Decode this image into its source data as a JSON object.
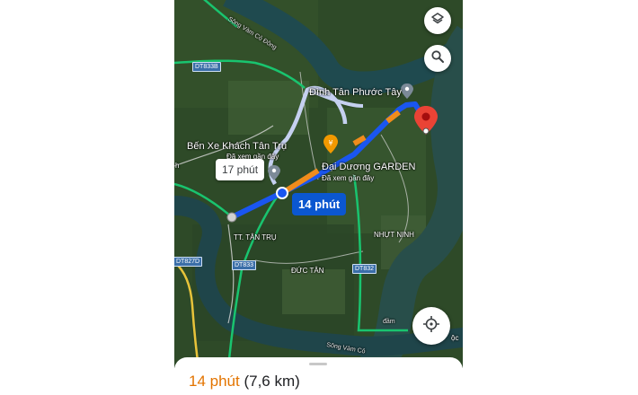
{
  "route": {
    "main_time": "14 phút",
    "alt_time": "17 phút"
  },
  "places": {
    "dest": "Đình Tân Phước Tây",
    "bus": "Bến Xe Khách Tân Trụ",
    "bus_sub": "Đã xem gần đây",
    "garden": "Đại Dương GARDEN",
    "garden_sub": "Đã xem gần đây",
    "town": "TT. TÂN TRỤ",
    "duc_tan": "ĐỨC TÂN",
    "nhut_ninh": "NHỰT NINH"
  },
  "roads": {
    "dt833b": "DT833B",
    "dt827d": "DT827D",
    "dt833": "DT833",
    "dt832": "DT832"
  },
  "rivers": {
    "top": "Sông Vàm Cỏ Đông",
    "bottom": "Sông Vàm Cỏ"
  },
  "partial": {
    "left_h": "h",
    "dam": "đầm",
    "oc": "ộc"
  },
  "sheet": {
    "duration": "14 phút",
    "distance": "(7,6 km)"
  },
  "icons": {
    "layers": "layers-icon",
    "search": "search-icon",
    "locate": "my-location-icon",
    "destination": "destination-pin-icon",
    "restaurant": "restaurant-pin-icon"
  },
  "colors": {
    "route": "#1a56f0",
    "traffic": "#f08c1c",
    "alt_route": "#c5d0f0",
    "major_road": "#19c46f",
    "pin": "#ea4335",
    "duration_text": "#e37400"
  }
}
